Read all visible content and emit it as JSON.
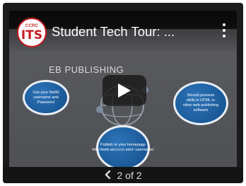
{
  "video": {
    "title": "Student Tech Tour: ...",
    "logo": {
      "small": "CCRC",
      "main": "ITS"
    },
    "menu_icon": "more-vert-icon",
    "play_icon": "play-icon"
  },
  "slide": {
    "heading": "EB PUBLISHING",
    "bubbles": [
      "Use your NetID username and Password",
      "Should possess skills in HTML or other web publishing software",
      "Publish to your homepage http://web.ad.cccrc.edu/~username/"
    ]
  },
  "pager": {
    "prev_icon": "chevron-left-icon",
    "label": "2 of 2"
  }
}
